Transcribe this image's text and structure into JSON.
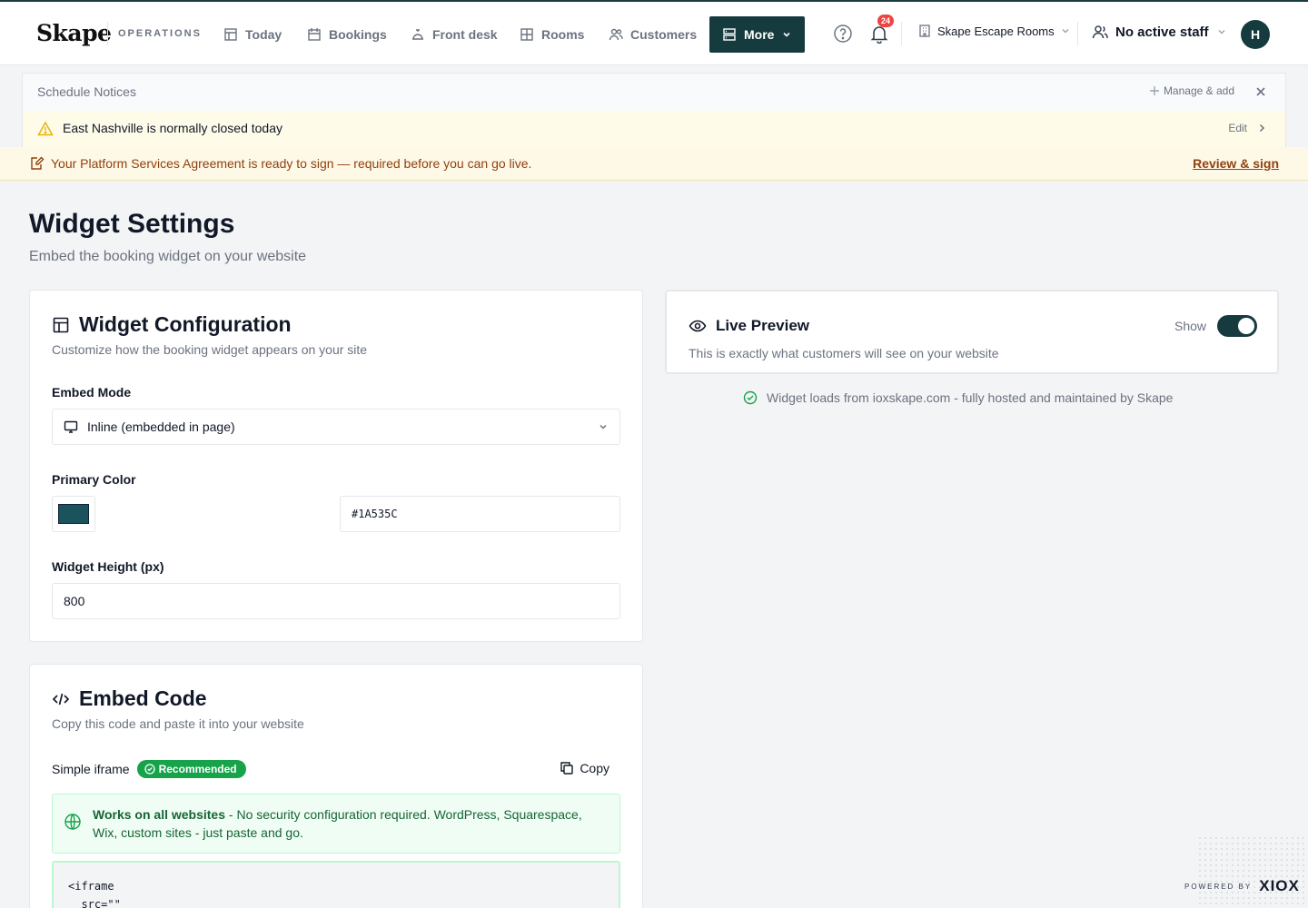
{
  "nav": {
    "logo": "Skape",
    "section": "OPERATIONS",
    "items": [
      {
        "label": "Today",
        "icon": "table-icon"
      },
      {
        "label": "Bookings",
        "icon": "calendar-icon"
      },
      {
        "label": "Front desk",
        "icon": "concierge-bell-icon"
      },
      {
        "label": "Rooms",
        "icon": "grid-icon"
      },
      {
        "label": "Customers",
        "icon": "users-icon"
      },
      {
        "label": "More",
        "icon": "server-icon"
      }
    ],
    "notification_count": "24",
    "venue": "Skape Escape Rooms",
    "staff": "No active staff",
    "avatar_initial": "H"
  },
  "notices": {
    "title": "Schedule Notices",
    "manage_label": "Manage & add",
    "items": [
      {
        "text": "East Nashville is normally closed today",
        "action": "Edit"
      }
    ]
  },
  "agreement": {
    "text": "Your Platform Services Agreement is ready to sign — required before you can go live.",
    "action": "Review & sign"
  },
  "page": {
    "title": "Widget Settings",
    "subtitle": "Embed the booking widget on your website"
  },
  "config": {
    "title": "Widget Configuration",
    "description": "Customize how the booking widget appears on your site",
    "embed_mode_label": "Embed Mode",
    "embed_mode_value": "Inline (embedded in page)",
    "primary_color_label": "Primary Color",
    "primary_color_value": "#1A535C",
    "height_label": "Widget Height (px)",
    "height_value": "800"
  },
  "embed": {
    "title": "Embed Code",
    "description": "Copy this code and paste it into your website",
    "option_label": "Simple iframe",
    "badge": "Recommended",
    "copy_label": "Copy",
    "works_title": "Works on all websites",
    "works_text": " - No security configuration required. WordPress, Squarespace, Wix, custom sites - just paste and go.",
    "code": "<iframe\n  src=\"\""
  },
  "preview": {
    "title": "Live Preview",
    "description": "This is exactly what customers will see on your website",
    "toggle_label": "Show",
    "toggle_on": true,
    "hosted_text": "Widget loads from ioxskape.com - fully hosted and maintained by Skape"
  },
  "footer": {
    "powered_by": "POWERED BY",
    "brand": "XIOX"
  },
  "colors": {
    "brand": "#163b3f",
    "primary_swatch": "#1a535c",
    "success": "#16a34a",
    "warning_text": "#92400e",
    "notification": "#ef4444"
  }
}
